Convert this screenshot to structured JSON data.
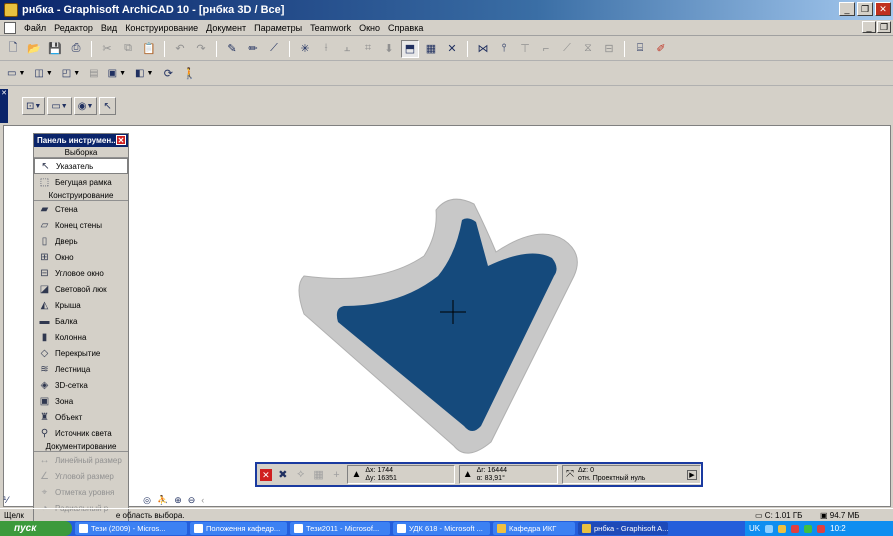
{
  "window": {
    "title": "рнбка - Graphisoft ArchiCAD 10 - [рнбка 3D / Все]",
    "buttons": [
      "_",
      "❐",
      "✕"
    ],
    "mdi_buttons": [
      "_",
      "❐"
    ]
  },
  "menu": [
    "Файл",
    "Редактор",
    "Вид",
    "Конструирование",
    "Документ",
    "Параметры",
    "Teamwork",
    "Окно",
    "Справка"
  ],
  "toolbox": {
    "title": "Панель инструмен...",
    "sections": {
      "selection": "Выборка",
      "construction": "Конструирование",
      "documentation": "Документирование"
    },
    "selection_items": [
      {
        "label": "Указатель",
        "icon": "pointer-icon",
        "glyph": "↖"
      },
      {
        "label": "Бегущая рамка",
        "icon": "marquee-icon",
        "glyph": "⬚"
      }
    ],
    "construction_items": [
      {
        "label": "Стена",
        "icon": "wall-icon",
        "glyph": "▰"
      },
      {
        "label": "Конец стены",
        "icon": "wall-end-icon",
        "glyph": "▱"
      },
      {
        "label": "Дверь",
        "icon": "door-icon",
        "glyph": "▯"
      },
      {
        "label": "Окно",
        "icon": "window-icon",
        "glyph": "⊞"
      },
      {
        "label": "Угловое окно",
        "icon": "corner-window-icon",
        "glyph": "⊟"
      },
      {
        "label": "Световой люк",
        "icon": "skylight-icon",
        "glyph": "◪"
      },
      {
        "label": "Крыша",
        "icon": "roof-icon",
        "glyph": "◭"
      },
      {
        "label": "Балка",
        "icon": "beam-icon",
        "glyph": "▬"
      },
      {
        "label": "Колонна",
        "icon": "column-icon",
        "glyph": "▮"
      },
      {
        "label": "Перекрытие",
        "icon": "slab-icon",
        "glyph": "◇"
      },
      {
        "label": "Лестница",
        "icon": "stair-icon",
        "glyph": "≋"
      },
      {
        "label": "3D-сетка",
        "icon": "mesh-icon",
        "glyph": "◈"
      },
      {
        "label": "Зона",
        "icon": "zone-icon",
        "glyph": "▣"
      },
      {
        "label": "Объект",
        "icon": "object-icon",
        "glyph": "♜"
      },
      {
        "label": "Источник света",
        "icon": "lamp-icon",
        "glyph": "⚲"
      }
    ],
    "documentation_items": [
      {
        "label": "Линейный размер",
        "icon": "linear-dimension-icon",
        "glyph": "↔"
      },
      {
        "label": "Угловой размер",
        "icon": "angular-dimension-icon",
        "glyph": "∠"
      },
      {
        "label": "Отметка уровня",
        "icon": "level-dimension-icon",
        "glyph": "⌖"
      },
      {
        "label": "Радиальный р",
        "icon": "radial-dimension-icon",
        "glyph": "◔"
      },
      {
        "label": "",
        "icon": "more-icon",
        "glyph": "…"
      }
    ]
  },
  "coordinate_box": {
    "dx_label": "Δx:",
    "dx": "1744",
    "dy_label": "Δy:",
    "dy": "16351",
    "dr_label": "Δr:",
    "dr": "16444",
    "angle_label": "α:",
    "angle": "83,91°",
    "dz_label": "Δz:",
    "dz": "0",
    "reference": "отн. Проектный нуль"
  },
  "status": {
    "hint_start": "Щелк",
    "hint_end": "е область выбора.",
    "disk": "C: 1.01 ГБ",
    "memory": "94.7 МБ"
  },
  "taskbar": {
    "start": "пуск",
    "tasks": [
      "Тези (2009) - Micros...",
      "Положення кафедр...",
      "Тези2011 - Microsof...",
      "УДК 618 - Microsoft ...",
      "Кафедра ИКГ",
      "рнбка - Graphisoft A..."
    ],
    "lang": "UK",
    "clock": "10:2"
  },
  "colors": {
    "titlebar": "#0a246a",
    "model_fill": "#154a7c",
    "model_rim": "#c8c8c8",
    "taskbar": "#245edb"
  }
}
